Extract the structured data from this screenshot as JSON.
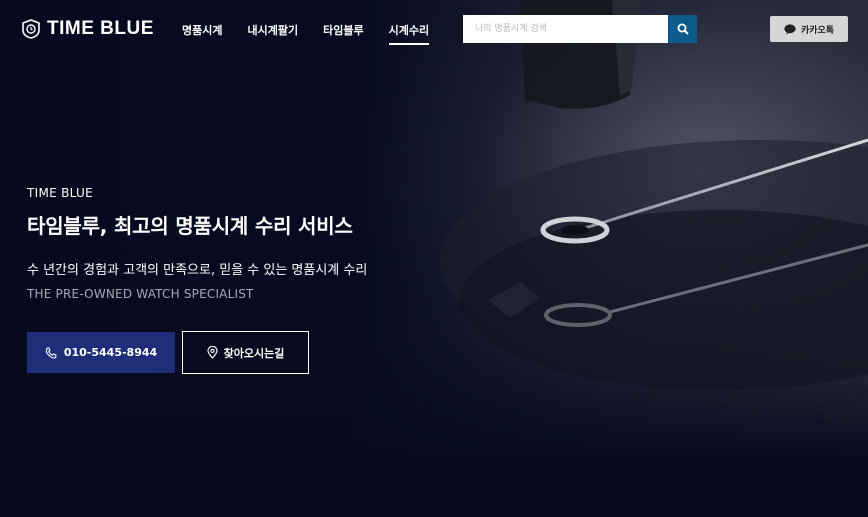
{
  "brand": {
    "name": "TIME BLUE",
    "icon": "watch-logo-icon"
  },
  "nav": {
    "items": [
      {
        "label": "명품시계",
        "active": false
      },
      {
        "label": "내시계팔기",
        "active": false
      },
      {
        "label": "타임블루",
        "active": false
      },
      {
        "label": "시계수리",
        "active": true
      }
    ]
  },
  "search": {
    "placeholder": "나의 명품시계 검색",
    "value": "",
    "button_icon": "search-icon"
  },
  "kakao": {
    "label": "카카오톡",
    "icon": "chat-bubble-icon"
  },
  "hero": {
    "eyebrow": "TIME BLUE",
    "title": "타임블루, 최고의 명품시계 수리 서비스",
    "description": "수 년간의 경험과 고객의 만족으로, 믿을 수 있는 명품시계 수리",
    "tagline": "THE PRE-OWNED WATCH SPECIALIST",
    "phone_button": {
      "label": "010-5445-8944",
      "icon": "phone-icon"
    },
    "map_button": {
      "label": "찾아오시는길",
      "icon": "map-pin-icon"
    }
  },
  "colors": {
    "background": "#070a1e",
    "accent_search": "#0d5b8c",
    "phone_button": "#1f2e78",
    "kakao_button": "#d6d6d6"
  }
}
